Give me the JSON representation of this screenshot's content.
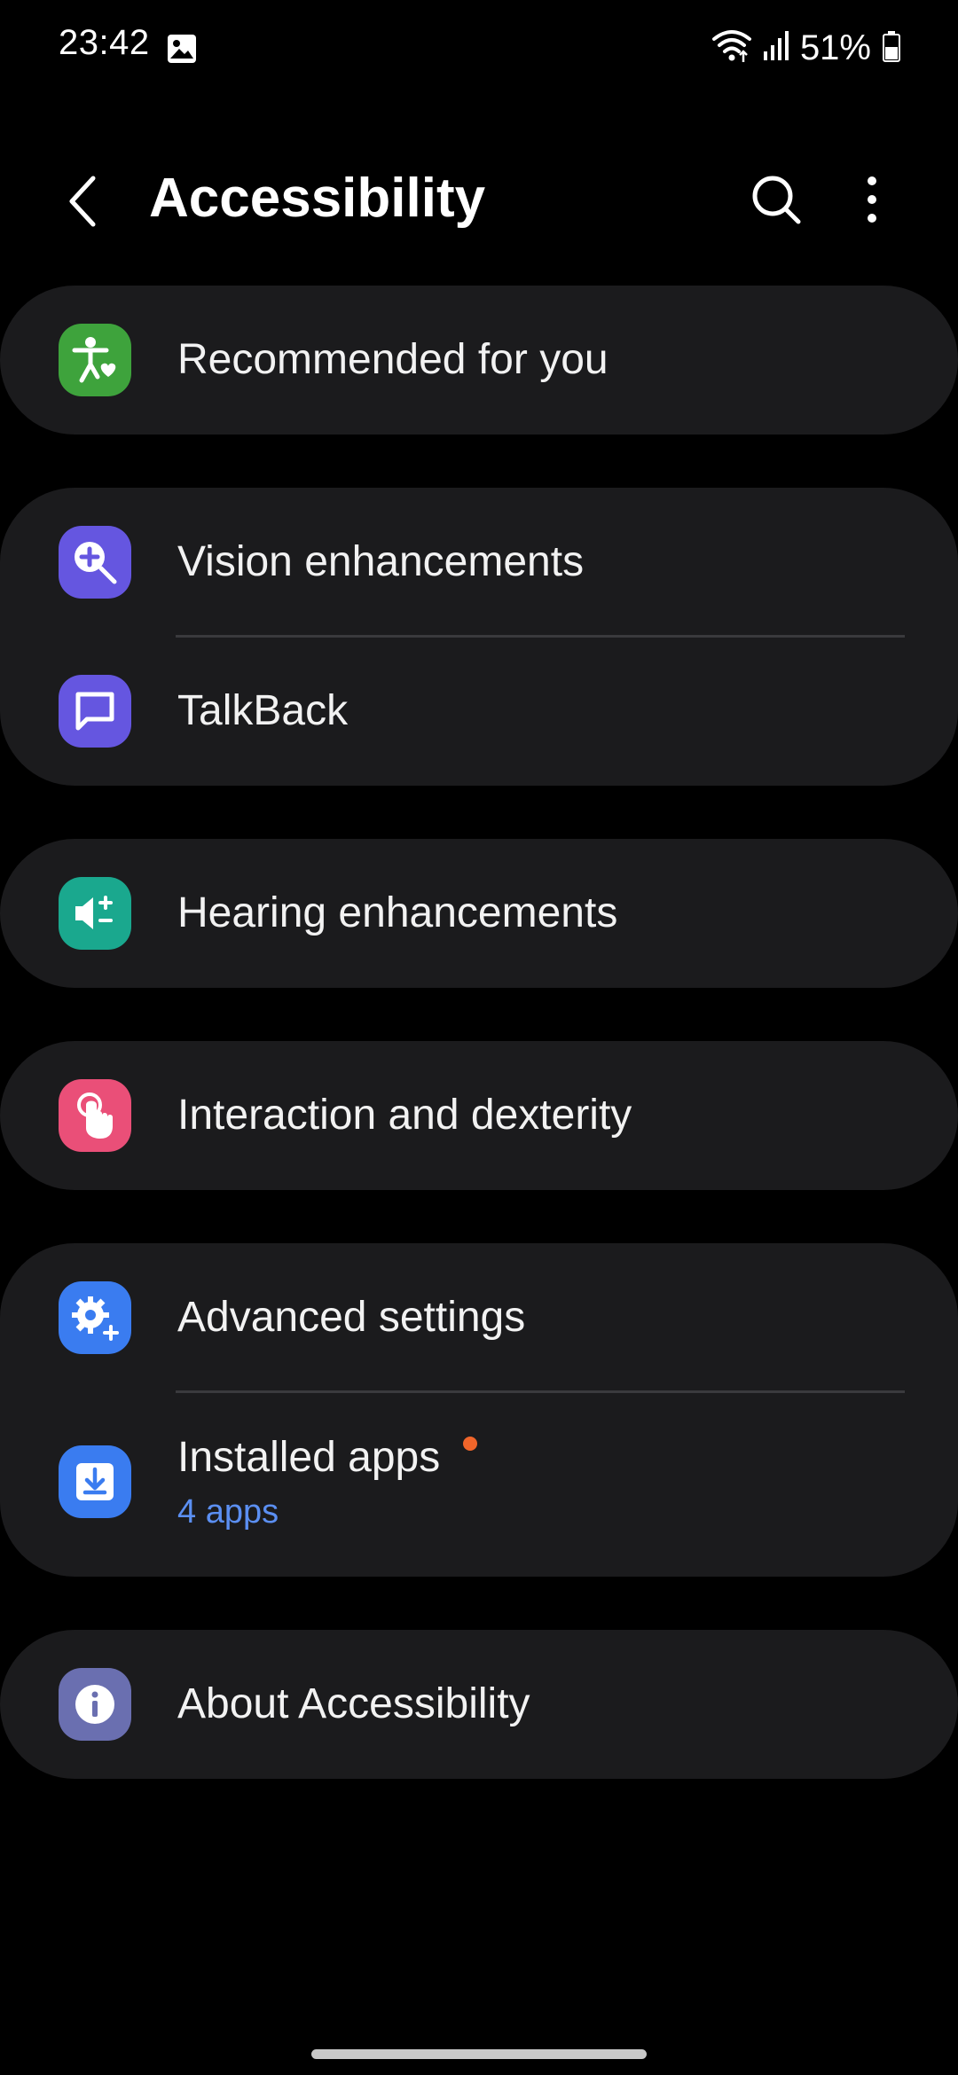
{
  "status": {
    "time": "23:42",
    "battery": "51%",
    "icons": [
      "gallery-icon",
      "wifi-icon",
      "signal-icon",
      "battery-icon"
    ]
  },
  "header": {
    "title": "Accessibility",
    "icons": [
      "back-icon",
      "search-icon",
      "more-vert-icon"
    ]
  },
  "items": {
    "recommended": {
      "label": "Recommended for you",
      "icon": "accessibility-person-heart-icon",
      "color": "#3ea33c"
    },
    "vision": {
      "label": "Vision enhancements",
      "icon": "zoom-in-icon",
      "color": "#6556e0"
    },
    "talkback": {
      "label": "TalkBack",
      "icon": "chat-bubble-icon",
      "color": "#6556e0"
    },
    "hearing": {
      "label": "Hearing enhancements",
      "icon": "volume-plus-minus-icon",
      "color": "#1aa88e"
    },
    "interaction": {
      "label": "Interaction and dexterity",
      "icon": "touch-hand-icon",
      "color": "#ea4f78"
    },
    "advanced": {
      "label": "Advanced settings",
      "icon": "gear-plus-icon",
      "color": "#3a7cf0"
    },
    "installed": {
      "label": "Installed apps",
      "sub": "4 apps",
      "icon": "download-box-icon",
      "color": "#3a7cf0",
      "badge_color": "#f0652a"
    },
    "about": {
      "label": "About Accessibility",
      "icon": "info-icon",
      "color": "#6a6fb0"
    }
  }
}
